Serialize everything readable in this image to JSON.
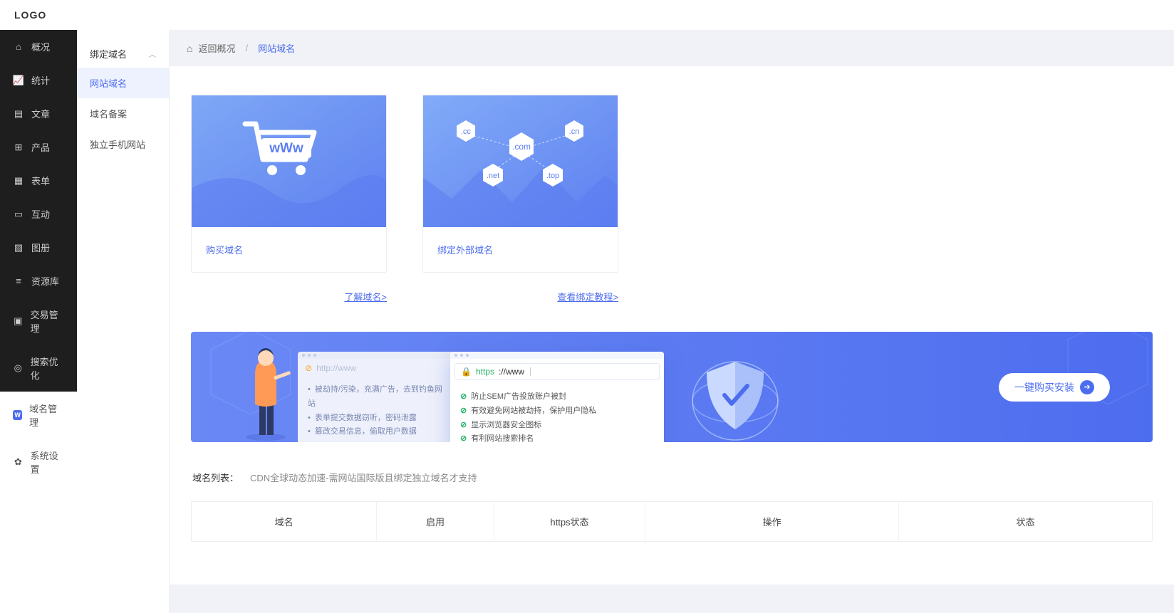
{
  "logo": "LOGO",
  "sidebar": {
    "items": [
      {
        "label": "概况",
        "icon": "home"
      },
      {
        "label": "统计",
        "icon": "chart"
      },
      {
        "label": "文章",
        "icon": "file"
      },
      {
        "label": "产品",
        "icon": "grid"
      },
      {
        "label": "表单",
        "icon": "form"
      },
      {
        "label": "互动",
        "icon": "chat"
      },
      {
        "label": "图册",
        "icon": "image"
      },
      {
        "label": "资源库",
        "icon": "database"
      },
      {
        "label": "交易管理",
        "icon": "transaction"
      },
      {
        "label": "搜索优化",
        "icon": "target"
      }
    ],
    "light_items": [
      {
        "label": "域名管理",
        "badge": "W",
        "active": true
      },
      {
        "label": "系统设置",
        "icon": "gear"
      }
    ]
  },
  "subsidebar": {
    "title": "绑定域名",
    "items": [
      {
        "label": "网站域名",
        "active": true
      },
      {
        "label": "域名备案"
      },
      {
        "label": "独立手机网站"
      }
    ]
  },
  "breadcrumb": {
    "back": "返回概况",
    "current": "网站域名"
  },
  "cards": [
    {
      "label": "购买域名",
      "link": "了解域名>"
    },
    {
      "label": "绑定外部域名",
      "link": "查看绑定教程>"
    }
  ],
  "banner": {
    "bad_url": "http://www",
    "bad_points": [
      "被劫持/污染，充满广告，去到钓鱼网站",
      "表单提交数据窃听，密码泄露",
      "篡改交易信息，偷取用户数据"
    ],
    "good_url_https": "https",
    "good_url_rest": "://www",
    "good_points": [
      "防止SEM广告投放账户被封",
      "有效避免网站被劫持，保护用户隐私",
      "显示浏览器安全图标",
      "有利网站搜索排名"
    ],
    "cta": "一键购买安装"
  },
  "domain_list": {
    "title": "域名列表：",
    "hint": "CDN全球动态加速-需网站国际版且绑定独立域名才支持",
    "columns": [
      "域名",
      "启用",
      "https状态",
      "操作",
      "状态"
    ]
  },
  "card_tlds": [
    ".cc",
    ".com",
    ".cn",
    ".net",
    ".top"
  ]
}
